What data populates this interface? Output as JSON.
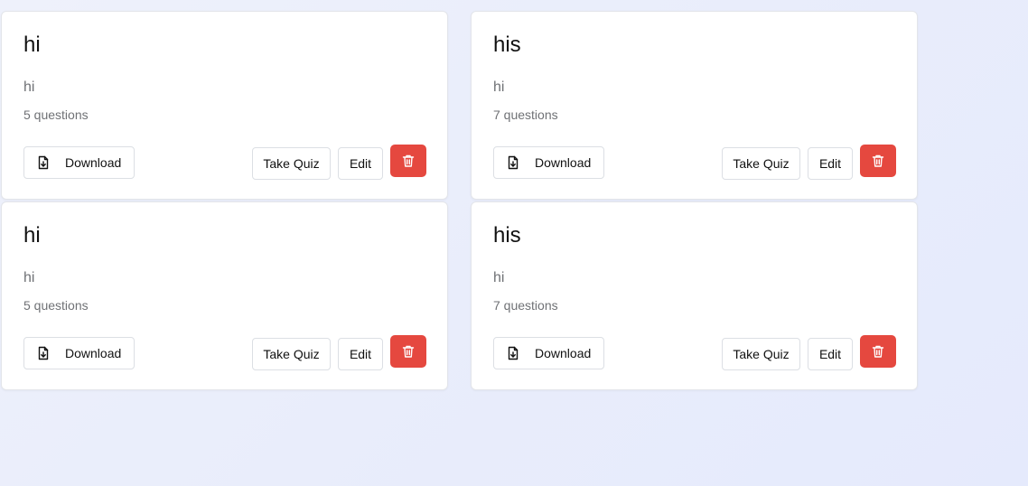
{
  "quizzes": [
    {
      "title": "hi",
      "description": "hi",
      "count": "5 questions",
      "download_label": "Download",
      "take_label": "Take Quiz",
      "edit_label": "Edit"
    },
    {
      "title": "his",
      "description": "hi",
      "count": "7 questions",
      "download_label": "Download",
      "take_label": "Take Quiz",
      "edit_label": "Edit"
    },
    {
      "title": "hi",
      "description": "hi",
      "count": "5 questions",
      "download_label": "Download",
      "take_label": "Take Quiz",
      "edit_label": "Edit"
    },
    {
      "title": "his",
      "description": "hi",
      "count": "7 questions",
      "download_label": "Download",
      "take_label": "Take Quiz",
      "edit_label": "Edit"
    }
  ],
  "icons": {
    "download": "file-download-icon",
    "delete": "trash-icon"
  },
  "colors": {
    "delete_button": "#e5483f",
    "title_text": "#111111",
    "muted_text": "#6f7175"
  }
}
